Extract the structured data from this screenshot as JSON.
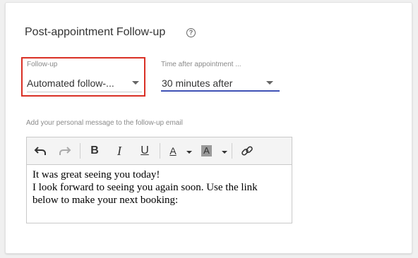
{
  "section": {
    "title": "Post-appointment Follow-up",
    "help_icon": "question-circle-icon"
  },
  "followup_field": {
    "label": "Follow-up",
    "value": "Automated follow-..."
  },
  "time_field": {
    "label": "Time after appointment ...",
    "value": "30 minutes after",
    "accent_color": "#3f51b5"
  },
  "message": {
    "label": "Add your personal message to the follow-up email",
    "toolbar": {
      "undo_icon": "undo-icon",
      "redo_icon": "redo-icon",
      "bold": "B",
      "italic": "I",
      "underline": "U",
      "font_color": "A",
      "highlight_color": "A",
      "link_icon": "link-icon"
    },
    "lines": [
      "It was great seeing you today!",
      "I look forward to seeing you again soon. Use the link",
      "below to make your next booking:"
    ]
  },
  "colors": {
    "error_border": "#d93025",
    "underline_active": "#3f51b5"
  }
}
